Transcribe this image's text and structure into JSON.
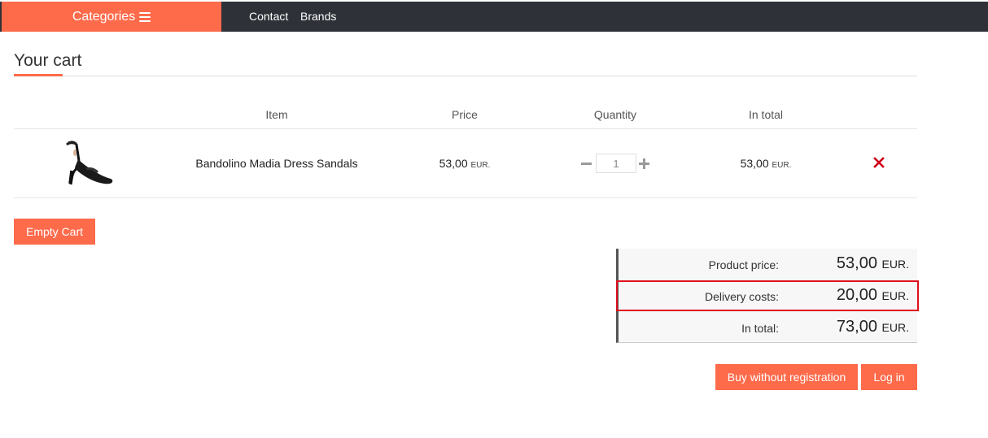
{
  "nav": {
    "categories_label": "Categories",
    "links": [
      "Contact",
      "Brands"
    ]
  },
  "page": {
    "title": "Your cart"
  },
  "table": {
    "headers": [
      "Item",
      "Price",
      "Quantity",
      "In total"
    ],
    "rows": [
      {
        "item": "Bandolino Madia Dress Sandals",
        "price": "53,00",
        "price_currency": "EUR.",
        "quantity": "1",
        "total": "53,00",
        "total_currency": "EUR."
      }
    ]
  },
  "actions": {
    "empty_cart": "Empty Cart",
    "buy_without_registration": "Buy without registration",
    "log_in": "Log in"
  },
  "summary": {
    "product_price_label": "Product price:",
    "product_price_value": "53,00",
    "delivery_label": "Delivery costs:",
    "delivery_value": "20,00",
    "total_label": "In total:",
    "total_value": "73,00",
    "currency": "EUR."
  },
  "colors": {
    "accent": "#fe6b4b",
    "navbar": "#2e3138",
    "remove": "#d0021b",
    "highlight": "#e0101e"
  },
  "icons": {
    "menu": "hamburger-icon",
    "minus": "minus-icon",
    "plus": "plus-icon",
    "remove": "close-icon"
  }
}
